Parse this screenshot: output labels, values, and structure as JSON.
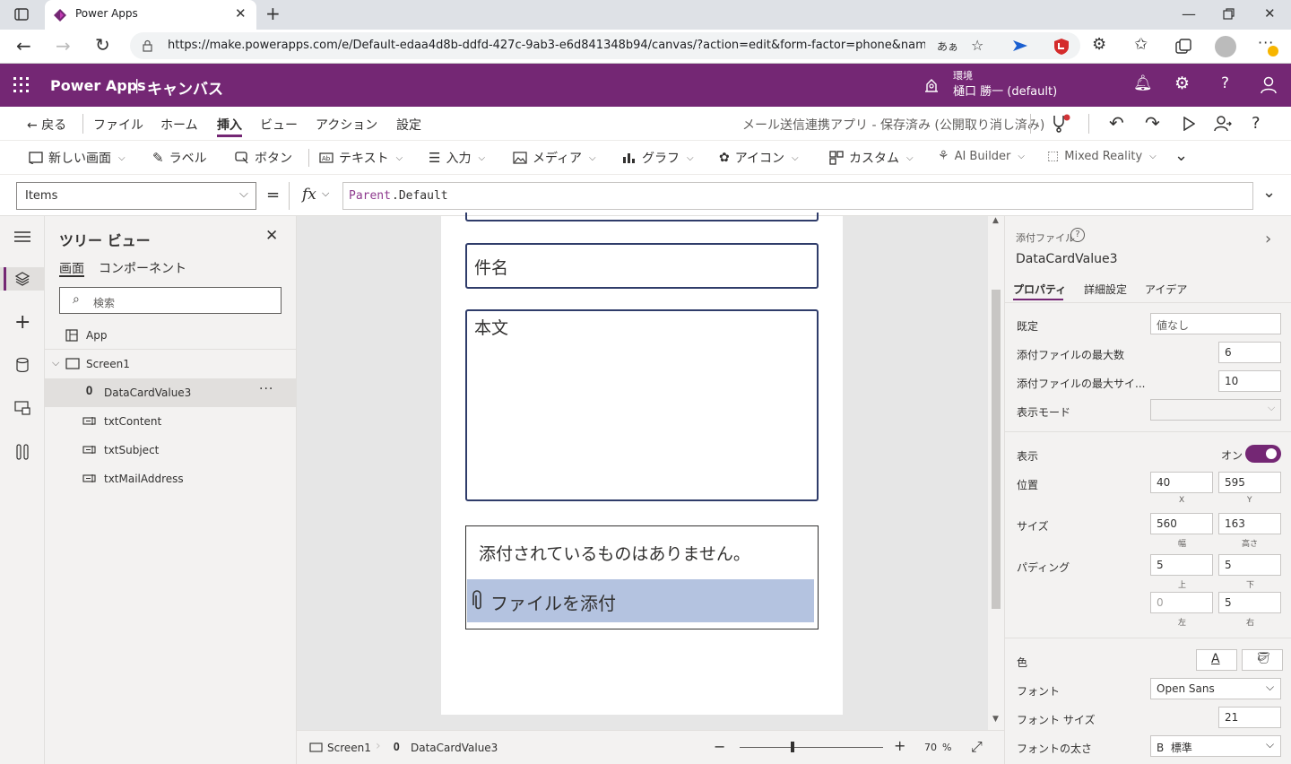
{
  "browser": {
    "tab_title": "Power Apps",
    "url": "https://make.powerapps.com/e/Default-edaa4d8b-ddfd-427c-9ab3-e6d841348b94/canvas/?action=edit&form-factor=phone&name=...",
    "reader_label": "あ&"
  },
  "app_header": {
    "product": "Power Apps",
    "separator": "|",
    "section": "キャンバス",
    "env_label": "環境",
    "env_name": "樋口 勝一 (default)"
  },
  "command_bar": {
    "back": "戻る",
    "menus": [
      "ファイル",
      "ホーム",
      "挿入",
      "ビュー",
      "アクション",
      "設定"
    ],
    "active_menu": "挿入",
    "app_status": "メール送信連携アプリ - 保存済み (公開取り消し済み)"
  },
  "insert_bar": {
    "new_screen": "新しい画面",
    "label": "ラベル",
    "button": "ボタン",
    "text": "テキスト",
    "input": "入力",
    "media": "メディア",
    "chart": "グラフ",
    "icon": "アイコン",
    "custom": "カスタム",
    "ai_builder": "AI Builder",
    "mixed_reality": "Mixed Reality"
  },
  "formula_bar": {
    "property": "Items",
    "equals": "=",
    "fx": "fx",
    "formula_keyword": "Parent",
    "formula_rest": ".Default"
  },
  "tree_view": {
    "title": "ツリー ビュー",
    "tabs": [
      "画面",
      "コンポーネント"
    ],
    "search_placeholder": "検索",
    "app_item": "App",
    "screen_item": "Screen1",
    "children": [
      "DataCardValue3",
      "txtContent",
      "txtSubject",
      "txtMailAddress"
    ],
    "more": "···"
  },
  "canvas": {
    "subject_placeholder": "件名",
    "body_placeholder": "本文",
    "no_attachments": "添付されているものはありません。",
    "attach_file": "ファイルを添付"
  },
  "status_bar": {
    "screen": "Screen1",
    "control": "DataCardValue3",
    "zoom_minus": "−",
    "zoom_plus": "+",
    "zoom_value": "70",
    "zoom_unit": "%",
    "zoom_fraction": 0.7
  },
  "properties": {
    "control_type": "添付ファイル",
    "control_name": "DataCardValue3",
    "tabs": [
      "プロパティ",
      "詳細設定",
      "アイデア"
    ],
    "default_label": "既定",
    "default_value": "値なし",
    "max_attachments_label": "添付ファイルの最大数",
    "max_attachments_value": "6",
    "max_size_label": "添付ファイルの最大サイ...",
    "max_size_value": "10",
    "display_mode_label": "表示モード",
    "visible_label": "表示",
    "visible_state": "オン",
    "position_label": "位置",
    "pos_x": "40",
    "pos_y": "595",
    "pos_x_label": "X",
    "pos_y_label": "Y",
    "size_label": "サイズ",
    "width": "560",
    "height": "163",
    "width_label": "幅",
    "height_label": "高さ",
    "padding_label": "パディング",
    "pad_top": "5",
    "pad_bottom": "5",
    "pad_left": "0",
    "pad_right": "5",
    "pad_top_label": "上",
    "pad_bottom_label": "下",
    "pad_left_label": "左",
    "pad_right_label": "右",
    "color_label": "色",
    "font_color_glyph": "A",
    "font_label": "フォント",
    "font_value": "Open Sans",
    "font_size_label": "フォント サイズ",
    "font_size_value": "21",
    "font_weight_label": "フォントの太さ",
    "font_weight_value": "B  標準"
  },
  "colors": {
    "brand": "#742774",
    "selection_fill": "#b4c3e0",
    "toggle_on": "#742774"
  }
}
